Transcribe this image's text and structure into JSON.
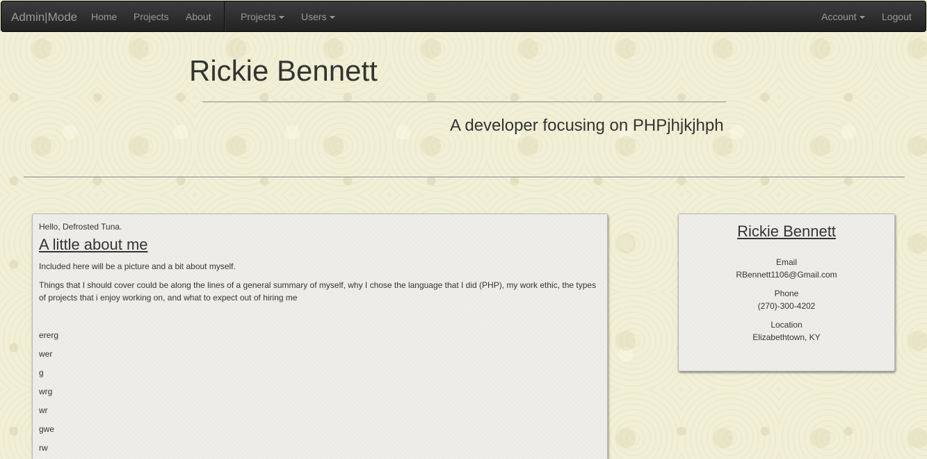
{
  "navbar": {
    "brand": "Admin|Mode",
    "left_links": [
      "Home",
      "Projects",
      "About"
    ],
    "dropdowns": [
      "Projects",
      "Users"
    ],
    "right": {
      "account": "Account",
      "logout": "Logout"
    }
  },
  "header": {
    "title": "Rickie Bennett",
    "subtitle": "A developer focusing on PHPjhjkjhph"
  },
  "about": {
    "greeting": "Hello, Defrosted Tuna.",
    "heading": "A little about me",
    "paragraphs": [
      "Included here will be a picture and a bit about myself.",
      "Things that I should cover could be along the lines of a general summary of myself, why I chose the language that I did (PHP), my work ethic, the types of projects that i enjoy working on, and what to expect out of hiring me"
    ],
    "items": [
      "ererg",
      "wer",
      "g",
      "wrg",
      "wr",
      "gwe",
      "rw"
    ]
  },
  "contact": {
    "name": "Rickie Bennett",
    "email_label": "Email",
    "email": "RBennett1106@Gmail.com",
    "phone_label": "Phone",
    "phone": "(270)-300-4202",
    "location_label": "Location",
    "location": "Elizabethtown, KY"
  }
}
